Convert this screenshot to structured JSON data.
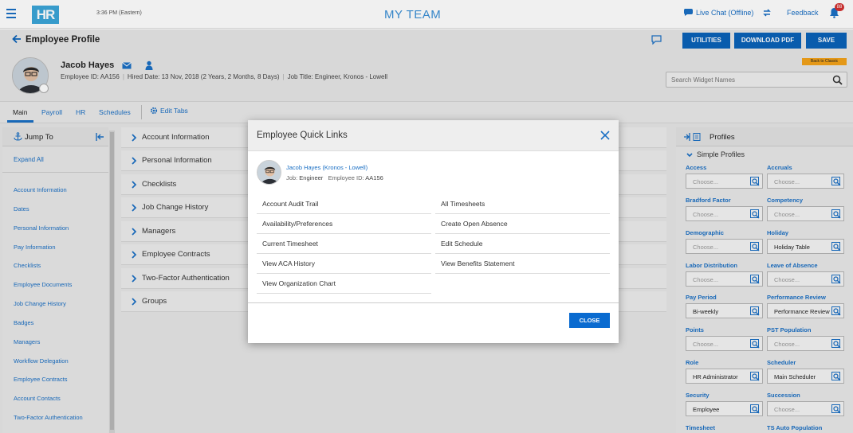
{
  "header": {
    "clock": "3:36 PM (Eastern)",
    "logo": "HR",
    "title": "MY TEAM",
    "live_chat": "Live Chat (Offline)",
    "feedback": "Feedback",
    "notification_count": "88"
  },
  "profile": {
    "page_title": "Employee Profile",
    "name": "Jacob Hayes",
    "employee_id": "Employee ID: AA156",
    "hired_date": "Hired Date: 13 Nov, 2018 (2 Years, 2 Months, 8 Days)",
    "job_title": "Job Title: Engineer, Kronos - Lowell",
    "buttons": {
      "utilities": "UTILITIES",
      "download_pdf": "DOWNLOAD PDF",
      "save": "SAVE"
    },
    "back_to_classic": "Back to Classic",
    "widget_search_placeholder": "Search Widget Names"
  },
  "tabs": {
    "main": "Main",
    "payroll": "Payroll",
    "hr": "HR",
    "schedules": "Schedules",
    "edit_tabs": "Edit Tabs"
  },
  "jump_to": {
    "title": "Jump To",
    "expand_all": "Expand All",
    "items": [
      "Account Information",
      "Dates",
      "Personal Information",
      "Pay Information",
      "Checklists",
      "Employee Documents",
      "Job Change History",
      "Badges",
      "Managers",
      "Workflow Delegation",
      "Employee Contracts",
      "Account Contacts",
      "Two-Factor Authentication"
    ]
  },
  "sections": [
    "Account Information",
    "Personal Information",
    "Checklists",
    "Job Change History",
    "Managers",
    "Employee Contracts",
    "Two-Factor Authentication",
    "Groups"
  ],
  "profiles": {
    "title": "Profiles",
    "simple_title": "Simple Profiles",
    "items": [
      {
        "label": "Access",
        "value": "Choose...",
        "filled": false
      },
      {
        "label": "Accruals",
        "value": "Choose...",
        "filled": false
      },
      {
        "label": "Bradford Factor",
        "value": "Choose...",
        "filled": false
      },
      {
        "label": "Competency",
        "value": "Choose...",
        "filled": false
      },
      {
        "label": "Demographic",
        "value": "Choose...",
        "filled": false
      },
      {
        "label": "Holiday",
        "value": "Holiday Table",
        "filled": true
      },
      {
        "label": "Labor Distribution",
        "value": "Choose...",
        "filled": false
      },
      {
        "label": "Leave of Absence",
        "value": "Choose...",
        "filled": false
      },
      {
        "label": "Pay Period",
        "value": "Bi-weekly",
        "filled": true
      },
      {
        "label": "Performance Review",
        "value": "Performance Review",
        "filled": true
      },
      {
        "label": "Points",
        "value": "Choose...",
        "filled": false
      },
      {
        "label": "PST Population",
        "value": "Choose...",
        "filled": false
      },
      {
        "label": "Role",
        "value": "HR Administrator",
        "filled": true
      },
      {
        "label": "Scheduler",
        "value": "Main Scheduler",
        "filled": true
      },
      {
        "label": "Security",
        "value": "Employee",
        "filled": true
      },
      {
        "label": "Succession",
        "value": "Choose...",
        "filled": false
      },
      {
        "label": "Timesheet",
        "value": "",
        "filled": false
      },
      {
        "label": "TS Auto Population",
        "value": "",
        "filled": false
      }
    ]
  },
  "modal": {
    "title": "Employee Quick Links",
    "employee_link": "Jacob Hayes (Kronos - Lowell)",
    "job_label": "Job:",
    "job_value": "Engineer",
    "id_label": "Employee ID:",
    "id_value": "AA156",
    "links_left": [
      "Account Audit Trail",
      "Availability/Preferences",
      "Current Timesheet",
      "View ACA History",
      "View Organization Chart"
    ],
    "links_right": [
      "All Timesheets",
      "Create Open Absence",
      "Edit Schedule",
      "View Benefits Statement"
    ],
    "close_label": "CLOSE"
  }
}
